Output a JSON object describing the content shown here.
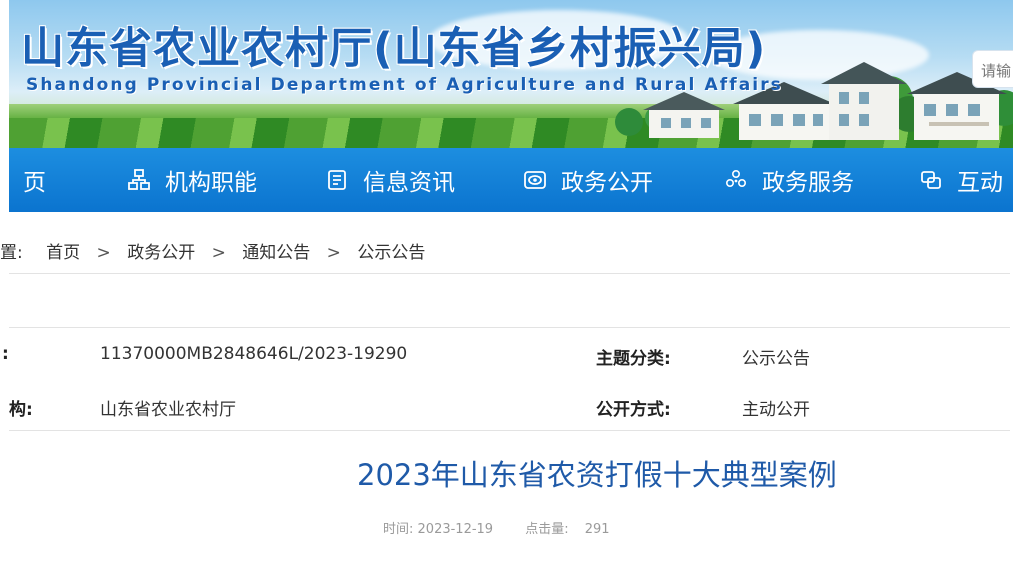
{
  "header": {
    "title": "山东省农业农村厅(山东省乡村振兴局)",
    "subtitle": "Shandong Provincial Department of Agriculture and Rural Affairs",
    "search_placeholder": "请输"
  },
  "nav": {
    "items": [
      {
        "label": "页",
        "icon": "none"
      },
      {
        "label": "机构职能",
        "icon": "org-chart-icon"
      },
      {
        "label": "信息资讯",
        "icon": "document-list-icon"
      },
      {
        "label": "政务公开",
        "icon": "eye-open-icon"
      },
      {
        "label": "政务服务",
        "icon": "service-cluster-icon"
      },
      {
        "label": "互动",
        "icon": "interaction-icon"
      }
    ]
  },
  "breadcrumb": {
    "prefix": "置:",
    "items": [
      "首页",
      "政务公开",
      "通知公告",
      "公示公告"
    ],
    "separator": ">"
  },
  "meta": {
    "row1": {
      "left_label": ":",
      "left_value": "11370000MB2848646L/2023-19290",
      "right_label": "主题分类:",
      "right_value": "公示公告"
    },
    "row2": {
      "left_label": "构:",
      "left_value": "山东省农业农村厅",
      "right_label": "公开方式:",
      "right_value": "主动公开"
    }
  },
  "article": {
    "title": "2023年山东省农资打假十大典型案例",
    "time_label": "时间:",
    "time_value": "2023-12-19",
    "views_label": "点击量:",
    "views_value": "291"
  },
  "colors": {
    "brand_blue": "#1a5fb4",
    "nav_blue": "#0b74cf",
    "title_blue": "#1f5aa8"
  }
}
